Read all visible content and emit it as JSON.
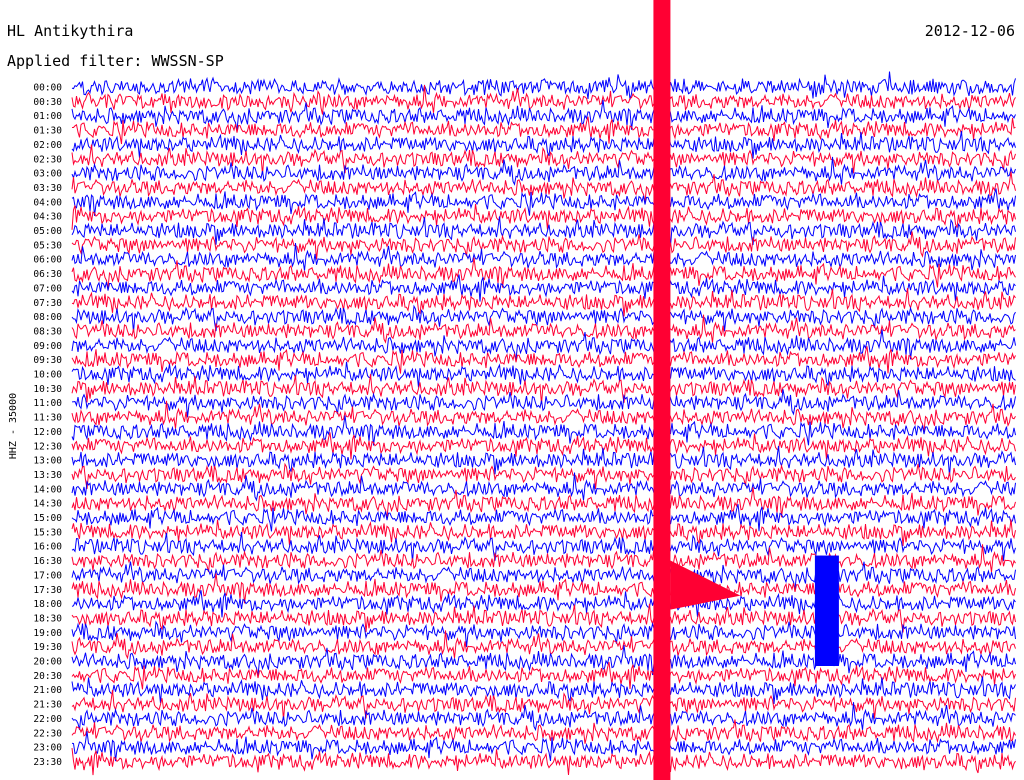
{
  "header": {
    "station": "HL Antikythira",
    "filter": "Applied filter: WWSSN-SP",
    "date": "2012-12-06"
  },
  "colors": {
    "trace_even": "#0000ff",
    "trace_odd": "#ff0033",
    "background": "#ffffff",
    "text": "#000000"
  },
  "chart_data": {
    "type": "line",
    "title": "HL Antikythira",
    "subtitle": "Applied filter: WWSSN-SP",
    "date": "2012-12-06",
    "ylabel": "HHZ - 35000",
    "xlabel": "",
    "row_minutes": 30,
    "rows": [
      "00:00",
      "00:30",
      "01:00",
      "01:30",
      "02:00",
      "02:30",
      "03:00",
      "03:30",
      "04:00",
      "04:30",
      "05:00",
      "05:30",
      "06:00",
      "06:30",
      "07:00",
      "07:30",
      "08:00",
      "08:30",
      "09:00",
      "09:30",
      "10:00",
      "10:30",
      "11:00",
      "11:30",
      "12:00",
      "12:30",
      "13:00",
      "13:30",
      "14:00",
      "14:30",
      "15:00",
      "15:30",
      "16:00",
      "16:30",
      "17:00",
      "17:30",
      "18:00",
      "18:30",
      "19:00",
      "19:30",
      "20:00",
      "20:30",
      "21:00",
      "21:30",
      "22:00",
      "22:30",
      "23:00",
      "23:30"
    ],
    "series": [
      {
        "color": "blue",
        "rows": "even"
      },
      {
        "color": "red",
        "rows": "odd"
      }
    ],
    "events": [
      {
        "description": "large earthquake signal saturating traces",
        "start_row": "00:00",
        "end_row": "23:30",
        "minute": 18.7
      },
      {
        "description": "local event burst",
        "start_row": "16:30",
        "end_row": "20:00",
        "minute": 23.8
      }
    ],
    "grid": false,
    "legend": "none"
  }
}
